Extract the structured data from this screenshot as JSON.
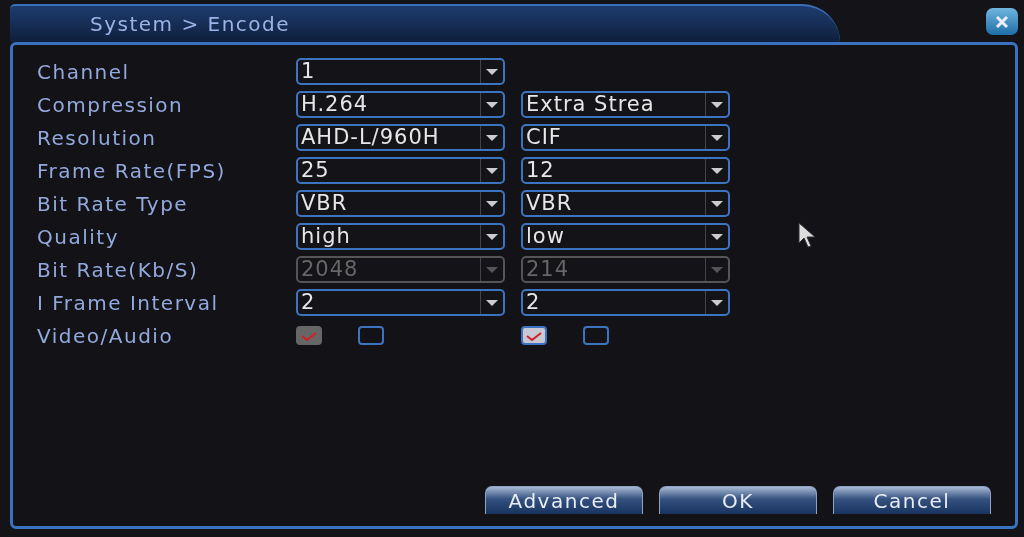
{
  "window": {
    "title": "System > Encode"
  },
  "rows": [
    {
      "label": "Channel",
      "kind": "select",
      "fields": [
        {
          "value": "1",
          "disabled": false
        }
      ]
    },
    {
      "label": "Compression",
      "kind": "select",
      "fields": [
        {
          "value": "H.264",
          "disabled": false
        },
        {
          "value": "Extra Strea",
          "disabled": false
        }
      ]
    },
    {
      "label": "Resolution",
      "kind": "select",
      "fields": [
        {
          "value": "AHD-L/960H",
          "disabled": false
        },
        {
          "value": "CIF",
          "disabled": false
        }
      ]
    },
    {
      "label": "Frame Rate(FPS)",
      "kind": "select",
      "fields": [
        {
          "value": "25",
          "disabled": false
        },
        {
          "value": "12",
          "disabled": false
        }
      ]
    },
    {
      "label": "Bit Rate Type",
      "kind": "select",
      "fields": [
        {
          "value": "VBR",
          "disabled": false
        },
        {
          "value": "VBR",
          "disabled": false
        }
      ]
    },
    {
      "label": "Quality",
      "kind": "select",
      "fields": [
        {
          "value": "high",
          "disabled": false
        },
        {
          "value": "low",
          "disabled": false
        }
      ]
    },
    {
      "label": "Bit Rate(Kb/S)",
      "kind": "select",
      "fields": [
        {
          "value": "2048",
          "disabled": true
        },
        {
          "value": "214",
          "disabled": true
        }
      ]
    },
    {
      "label": "I Frame Interval",
      "kind": "select",
      "fields": [
        {
          "value": "2",
          "disabled": false
        },
        {
          "value": "2",
          "disabled": false
        }
      ]
    },
    {
      "label": "Video/Audio",
      "kind": "checks",
      "fields": [
        {
          "checks": [
            {
              "checked": true,
              "disabled": true
            },
            {
              "checked": false,
              "disabled": false
            }
          ]
        },
        {
          "checks": [
            {
              "checked": true,
              "disabled": false
            },
            {
              "checked": false,
              "disabled": false
            }
          ]
        }
      ]
    }
  ],
  "buttons": [
    "Advanced",
    "OK",
    "Cancel"
  ]
}
